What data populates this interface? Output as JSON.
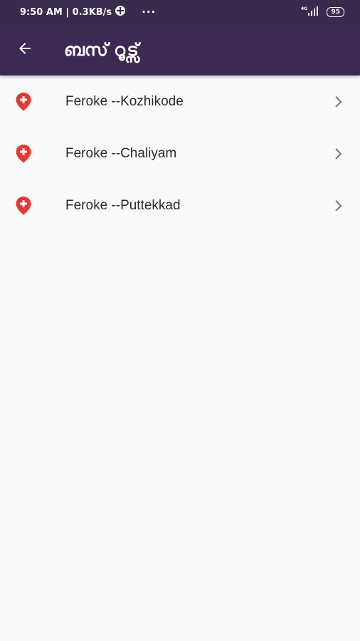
{
  "status": {
    "time_net": "9:50 AM | 0.3KB/s",
    "dots": "···",
    "signal_tag": "4G",
    "battery": "95"
  },
  "appbar": {
    "title": "ബസ് റൂട്സ്"
  },
  "routes": [
    {
      "label": "Feroke --Kozhikode"
    },
    {
      "label": "Feroke --Chaliyam"
    },
    {
      "label": "Feroke --Puttekkad"
    }
  ],
  "colors": {
    "status_bar": "#3a2a4d",
    "app_bar": "#3d2a54",
    "pin": "#e53935"
  }
}
